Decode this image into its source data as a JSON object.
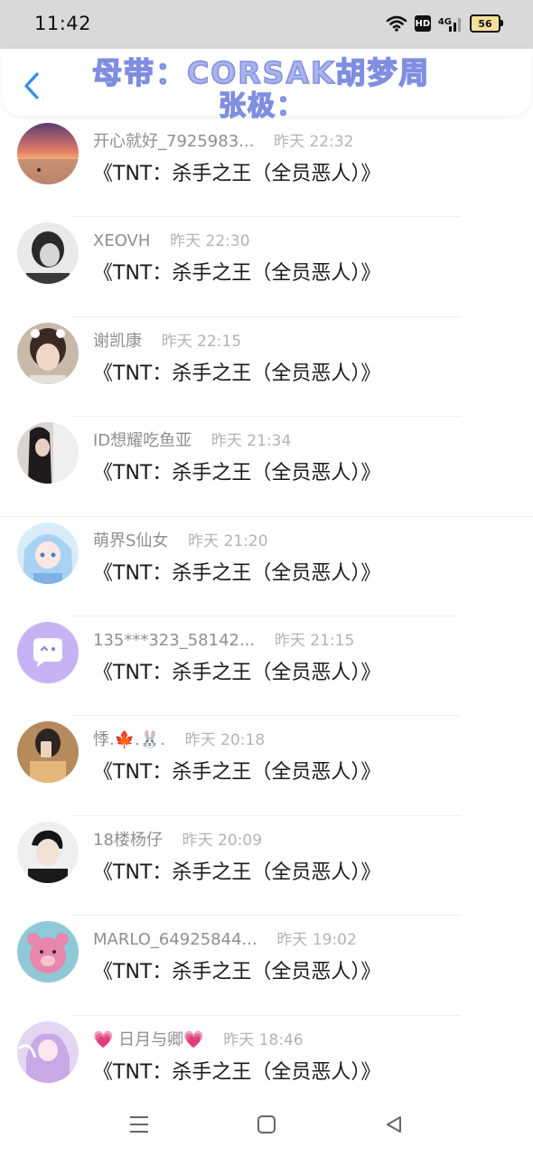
{
  "status": {
    "time": "11:42",
    "hd_label": "HD",
    "network_label": "4G",
    "battery_level": "56",
    "icons": [
      "wifi-icon",
      "hd-icon",
      "signal-icon",
      "battery-icon"
    ]
  },
  "header": {
    "back_icon": "chevron-left-icon",
    "title_line1": "母带：CORSAK胡梦周",
    "title_line2": "张极：",
    "accent_color": "#2e8ef0",
    "title_color": "#aab4ec"
  },
  "comments": [
    {
      "username": "开心就好_7925983...",
      "time": "昨天 22:32",
      "text": "《TNT：杀手之王（全员恶人）》",
      "avatar": "sunset-beach-avatar"
    },
    {
      "username": "XEOVH",
      "time": "昨天 22:30",
      "text": "《TNT：杀手之王（全员恶人）》",
      "avatar": "monochrome-portrait-avatar"
    },
    {
      "username": "谢凯康",
      "time": "昨天 22:15",
      "text": "《TNT：杀手之王（全员恶人）》",
      "avatar": "cat-filter-selfie-avatar"
    },
    {
      "username": "ID想耀吃鱼亚",
      "time": "昨天 21:34",
      "text": "《TNT：杀手之王（全员恶人）》",
      "avatar": "long-hair-girl-avatar"
    },
    {
      "username": "萌界S仙女",
      "time": "昨天 21:20",
      "text": "《TNT：杀手之王（全员恶人）》",
      "avatar": "anime-girl-avatar"
    },
    {
      "username": "135***323_58142...",
      "time": "昨天 21:15",
      "text": "《TNT：杀手之王（全员恶人）》",
      "avatar": "default-chat-bubble-avatar"
    },
    {
      "username": "悸.🍁.🐰.",
      "time": "昨天 20:18",
      "text": "《TNT：杀手之王（全员恶人）》",
      "avatar": "mirror-selfie-avatar"
    },
    {
      "username": "18楼杨仔",
      "time": "昨天 20:09",
      "text": "《TNT：杀手之王（全员恶人）》",
      "avatar": "boy-portrait-avatar"
    },
    {
      "username": "MARLO_64925844...",
      "time": "昨天 19:02",
      "text": "《TNT：杀手之王（全员恶人）》",
      "avatar": "pink-bear-avatar"
    },
    {
      "username": "💗 日月与卿💗",
      "time": "昨天 18:46",
      "text": "《TNT：杀手之王（全员恶人）》",
      "avatar": "fairy-anime-avatar"
    }
  ],
  "nav": {
    "menu_icon": "menu-icon",
    "home_icon": "home-square-icon",
    "back_icon": "back-triangle-icon"
  }
}
